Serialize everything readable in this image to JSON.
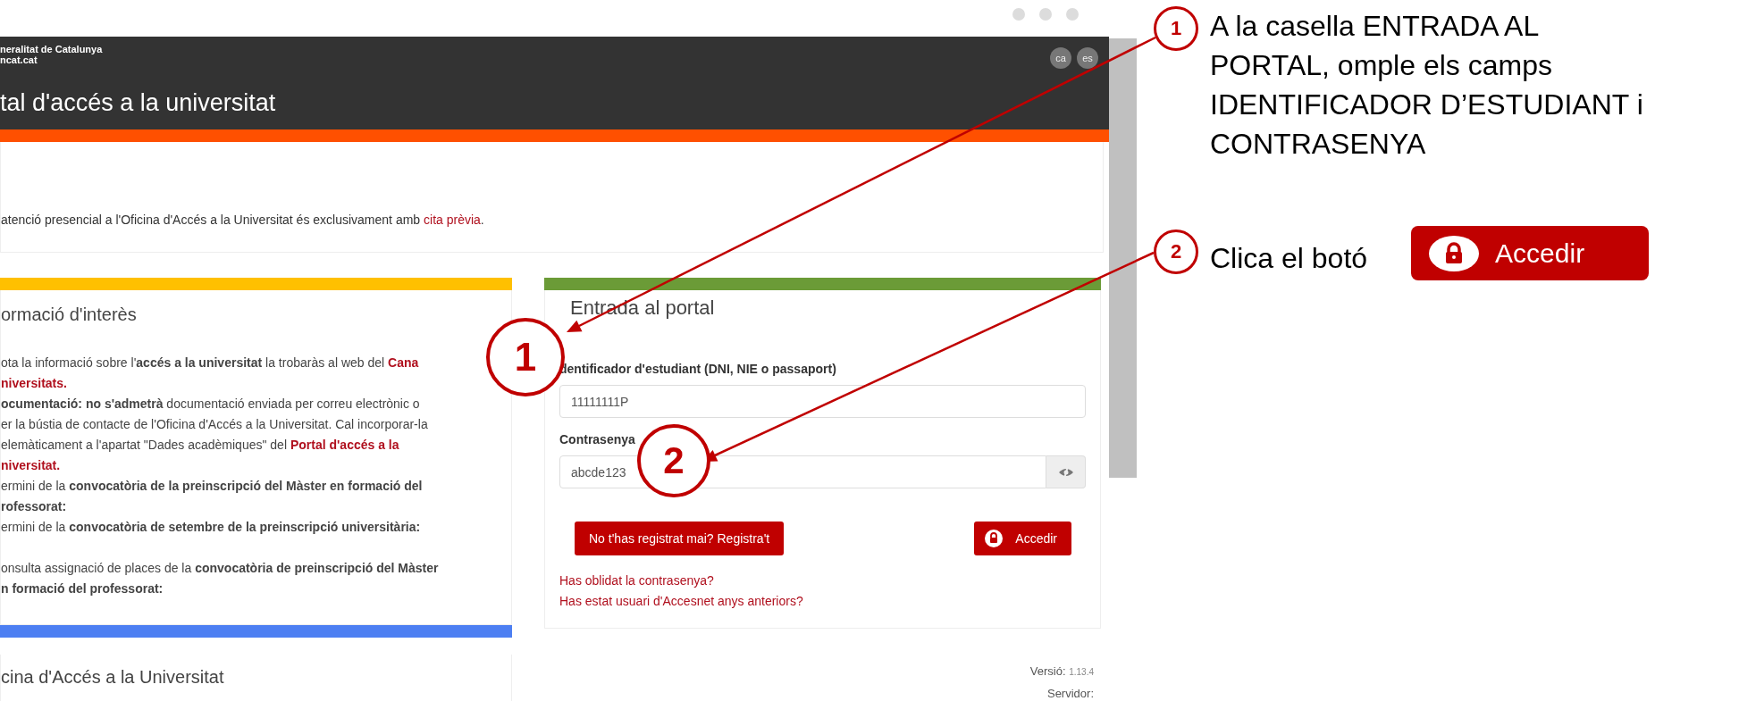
{
  "site": {
    "brand_lines": [
      "neralitat de Catalunya",
      "ncat.cat"
    ],
    "languages": [
      "ca",
      "es"
    ],
    "title": "tal d'accés a la universitat",
    "notice": {
      "text": "atenció presencial a l'Oficina d'Accés a la Universitat és exclusivament amb ",
      "link": "cita prèvia",
      "after": "."
    },
    "info": {
      "title": "ormació d'interès",
      "paragraphs": [
        [
          [
            {
              "kind": "text",
              "text": "ota la informació sobre l'**accés a la universitat** la trobaràs al web del "
            },
            {
              "kind": "link",
              "text": "Cana"
            }
          ],
          [
            {
              "kind": "link",
              "text": "niversitats."
            }
          ],
          [
            {
              "kind": "text",
              "text": "**ocumentació: no s'admetrà** documentació enviada per correu electrònic o"
            }
          ],
          [
            {
              "kind": "text",
              "text": "er la bústia de contacte de l'Oficina d'Accés a la Universitat. Cal incorporar-la"
            }
          ],
          [
            {
              "kind": "text",
              "text": "elemàticament a l'apartat \"Dades acadèmiques\" del "
            },
            {
              "kind": "link",
              "text": "Portal d'accés a la"
            }
          ],
          [
            {
              "kind": "link",
              "text": "niversitat."
            }
          ],
          [
            {
              "kind": "text",
              "text": "ermini de la **convocatòria de la preinscripció del Màster en formació del**"
            }
          ],
          [
            {
              "kind": "text",
              "text": "**rofessorat:**"
            }
          ],
          [
            {
              "kind": "text",
              "text": "ermini de la **convocatòria de setembre de la preinscripció universitària:**"
            }
          ]
        ],
        [
          [
            {
              "kind": "text",
              "text": "onsulta assignació de places de la **convocatòria de preinscripció del Màster**"
            }
          ],
          [
            {
              "kind": "text",
              "text": "**n formació del professorat:**"
            }
          ]
        ]
      ]
    },
    "office": {
      "title": "cina d'Accés a la Universitat"
    },
    "login": {
      "title": "Entrada al portal",
      "fields": [
        {
          "kind": "text",
          "label": "dentificador d'estudiant (DNI, NIE o passaport)",
          "value": "11111111P"
        },
        {
          "kind": "password",
          "label": "Contrasenya",
          "value": "abcde123"
        }
      ],
      "register_button": "No t'has registrat mai? Registra't",
      "submit_button": "Accedir",
      "links": [
        "Has oblidat la contrasenya?",
        "Has estat usuari d'Accesnet anys anteriors?"
      ]
    },
    "version": {
      "label": "Versió:",
      "value": "1.13.4",
      "server_label": "Servidor:"
    }
  },
  "callouts": [
    "1",
    "2"
  ],
  "notes": [
    {
      "number": "1",
      "text_lines": [
        "A la casella ENTRADA AL",
        "PORTAL, omple els camps",
        "IDENTIFICADOR D’ESTUDIANT i",
        "CONTRASENYA"
      ]
    },
    {
      "number": "2",
      "text_lines": [
        "Clica el botó"
      ],
      "button": "Accedir"
    }
  ]
}
